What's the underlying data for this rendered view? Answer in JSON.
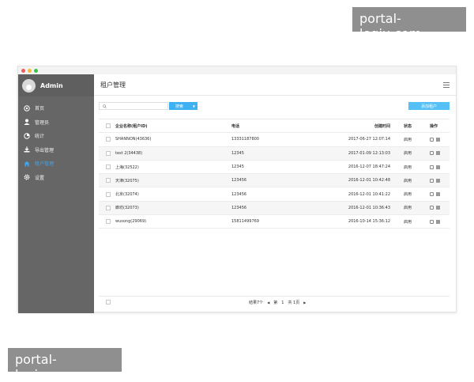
{
  "watermark": {
    "text": "portal-leqiu.com"
  },
  "window": {
    "dots": [
      "#f25c54",
      "#f5bd2e",
      "#3bc44a"
    ]
  },
  "sidebar": {
    "user": "Admin",
    "items": [
      {
        "label": "首页",
        "icon": "home-circle-icon",
        "active": false
      },
      {
        "label": "管理员",
        "icon": "user-icon",
        "active": false
      },
      {
        "label": "统计",
        "icon": "chart-icon",
        "active": false
      },
      {
        "label": "导出管理",
        "icon": "download-icon",
        "active": false
      },
      {
        "label": "租户管理",
        "icon": "house-icon",
        "active": true
      },
      {
        "label": "设置",
        "icon": "gear-icon",
        "active": false
      }
    ]
  },
  "header": {
    "title": "租户管理"
  },
  "toolbar": {
    "search_placeholder": "",
    "search_label": "搜索",
    "add_label": "添加租户"
  },
  "table": {
    "columns": [
      "企业名称(租户ID)",
      "电话",
      "创建时间",
      "状态",
      "操作"
    ],
    "rows": [
      {
        "name": "SHANNON(43636)",
        "phone": "13331187800",
        "time": "2017-06-27 12:07:14",
        "status": "启用"
      },
      {
        "name": "test 2(34438)",
        "phone": "12345",
        "time": "2017-01-09 12:13:03",
        "status": "启用"
      },
      {
        "name": "上海(32522)",
        "phone": "12345",
        "time": "2016-12-07 18:47:24",
        "status": "启用"
      },
      {
        "name": "天津(32075)",
        "phone": "123456",
        "time": "2016-12-01 10:42:48",
        "status": "启用"
      },
      {
        "name": "北京(32074)",
        "phone": "123456",
        "time": "2016-12-01 10:41:22",
        "status": "启用"
      },
      {
        "name": "廊坊(32073)",
        "phone": "123456",
        "time": "2016-12-01 10:36:43",
        "status": "启用"
      },
      {
        "name": "wusong(29069)",
        "phone": "15811499769",
        "time": "2016-10-14 15:36:12",
        "status": "启用"
      }
    ]
  },
  "footer": {
    "total": "结果7个",
    "page_prefix": "第",
    "page": "1",
    "page_total": "共 1页"
  }
}
